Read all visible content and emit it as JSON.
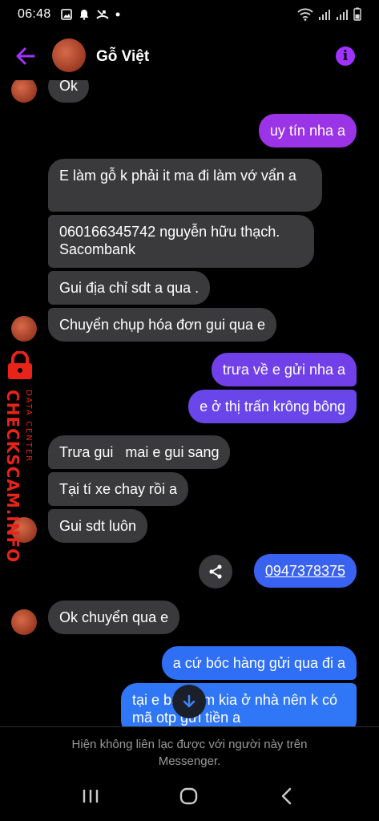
{
  "status": {
    "time": "06:48"
  },
  "header": {
    "name": "Gỗ Việt"
  },
  "messages": [
    {
      "side": "in",
      "text": "Ok"
    },
    {
      "side": "out",
      "text": "uy tín nha a",
      "color": "#9b33e6"
    },
    {
      "side": "in",
      "text": "E làm gỗ k phải it ma đi làm vớ vẩn a"
    },
    {
      "side": "in",
      "text": "060166345742 nguyễn hữu thạch. Sacombank"
    },
    {
      "side": "in",
      "text": "Gui địa chỉ sdt a qua ."
    },
    {
      "side": "in",
      "text": "Chuyển chụp hóa đơn gui qua e"
    },
    {
      "side": "out",
      "text": "trưa về e gửi nha a",
      "color": "#7140e8"
    },
    {
      "side": "out",
      "text": "e ở thị trấn krông bông",
      "color": "#6946ea"
    },
    {
      "side": "in",
      "text": "Trưa gui   mai e gui sang"
    },
    {
      "side": "in",
      "text": "Tại tí xe chay rồi a"
    },
    {
      "side": "in",
      "text": "Gui sdt luôn"
    },
    {
      "side": "out",
      "text": "0947378375",
      "color": "#3a62f0",
      "link": true
    },
    {
      "side": "in",
      "text": "Ok chuyển qua e"
    },
    {
      "side": "out",
      "text": "a cứ bóc hàng gửi qua đi a",
      "color": "#2f6ff5"
    },
    {
      "side": "out",
      "text": "tại e bận làm kia ở nhà nên k có mã otp gửi tiền a",
      "color": "#2f77f7"
    }
  ],
  "watermark": {
    "main": "CHECKSCAM.INFO",
    "sub": "DATA CENTER"
  },
  "footer": {
    "line1": "Hiện không liên lạc được với người này trên",
    "line2": "Messenger."
  },
  "colors": {
    "accent": "#a033ff",
    "incoming": "#3a3a3c",
    "background": "#000000"
  },
  "icons": [
    "back-arrow-icon",
    "info-icon",
    "share-icon",
    "arrow-down-icon",
    "recent-apps-icon",
    "home-icon",
    "back-nav-icon"
  ]
}
